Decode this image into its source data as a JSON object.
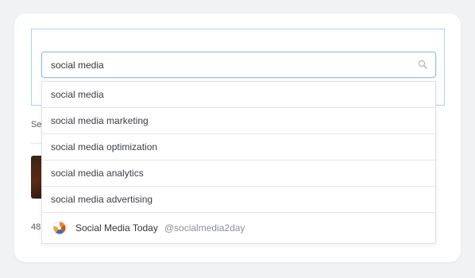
{
  "background": {
    "label_partial": "Se",
    "count_partial": "48"
  },
  "search": {
    "value": "social media",
    "icon": "search-icon"
  },
  "suggestions": [
    {
      "label": "social media"
    },
    {
      "label": "social media marketing"
    },
    {
      "label": "social media optimization"
    },
    {
      "label": "social media analytics"
    },
    {
      "label": "social media advertising"
    }
  ],
  "account_suggestion": {
    "name": "Social Media Today",
    "handle": "@socialmedia2day",
    "avatar_icon": "account-avatar-icon"
  },
  "colors": {
    "focus_border": "#8fc2e8",
    "panel_border": "#a9d3ef",
    "divider": "#e3e5e8",
    "text": "#3b3f45",
    "muted_text": "#8a8f96"
  }
}
